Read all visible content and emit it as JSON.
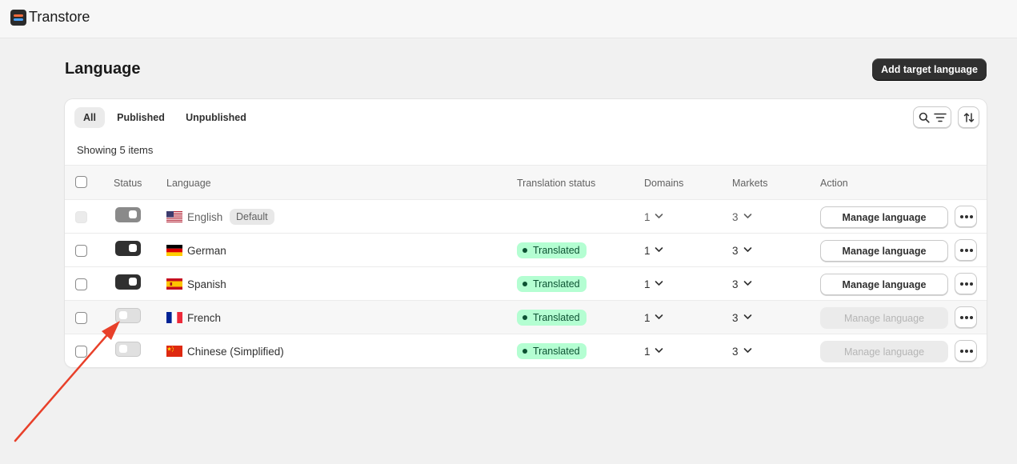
{
  "app": {
    "brand": "Transtore"
  },
  "page": {
    "title": "Language",
    "add_button": "Add target language"
  },
  "tabs": [
    {
      "label": "All",
      "active": true
    },
    {
      "label": "Published",
      "active": false
    },
    {
      "label": "Unpublished",
      "active": false
    }
  ],
  "toolbar": {
    "search_filter_icon": "search-filter-icon",
    "sort_icon": "sort-icon"
  },
  "summary": "Showing 5 items",
  "columns": {
    "status": "Status",
    "language": "Language",
    "translation_status": "Translation status",
    "domains": "Domains",
    "markets": "Markets",
    "action": "Action"
  },
  "rows": [
    {
      "language": "English",
      "default_badge": "Default",
      "flag": "us",
      "published": true,
      "translation_status": "",
      "domains": "1",
      "markets": "3",
      "action": "Manage language",
      "action_enabled": true
    },
    {
      "language": "German",
      "flag": "de",
      "published": true,
      "translation_status": "Translated",
      "domains": "1",
      "markets": "3",
      "action": "Manage language",
      "action_enabled": true
    },
    {
      "language": "Spanish",
      "flag": "es",
      "published": true,
      "translation_status": "Translated",
      "domains": "1",
      "markets": "3",
      "action": "Manage language",
      "action_enabled": true
    },
    {
      "language": "French",
      "flag": "fr",
      "published": false,
      "translation_status": "Translated",
      "domains": "1",
      "markets": "3",
      "action": "Manage language",
      "action_enabled": false
    },
    {
      "language": "Chinese (Simplified)",
      "flag": "cn",
      "published": false,
      "translation_status": "Translated",
      "domains": "1",
      "markets": "3",
      "action": "Manage language",
      "action_enabled": false
    }
  ],
  "colors": {
    "accent_dark": "#303030",
    "translated_bg": "#b4fed2",
    "translated_fg": "#0c5132",
    "annotation_arrow": "#e8402a"
  }
}
